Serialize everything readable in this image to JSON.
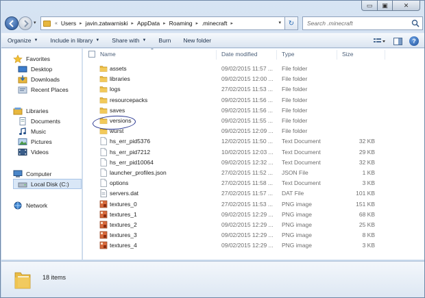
{
  "window": {
    "caption_buttons": {
      "minimize": "▭",
      "maximize": "▣",
      "close": "✕"
    }
  },
  "address_bar": {
    "overflow_marker": "«",
    "breadcrumbs": [
      "Users",
      "javin.zatwarniski",
      "AppData",
      "Roaming",
      ".minecraft"
    ],
    "dropdown_glyph": "▾",
    "refresh_glyph": "↻"
  },
  "search": {
    "placeholder": "Search .minecraft"
  },
  "toolbar": {
    "organize": "Organize",
    "include_in_library": "Include in library",
    "share_with": "Share with",
    "burn": "Burn",
    "new_folder": "New folder",
    "help": "?"
  },
  "nav_pane": {
    "favorites": "Favorites",
    "desktop": "Desktop",
    "downloads": "Downloads",
    "recent_places": "Recent Places",
    "libraries": "Libraries",
    "documents": "Documents",
    "music": "Music",
    "pictures": "Pictures",
    "videos": "Videos",
    "computer": "Computer",
    "local_disk": "Local Disk (C:)",
    "network": "Network"
  },
  "columns": {
    "name": "Name",
    "date_modified": "Date modified",
    "type": "Type",
    "size": "Size"
  },
  "files": [
    {
      "name": "assets",
      "date": "09/02/2015 11:57 ...",
      "type": "File folder",
      "size": "",
      "icon": "folder-icon"
    },
    {
      "name": "libraries",
      "date": "09/02/2015 12:00 ...",
      "type": "File folder",
      "size": "",
      "icon": "folder-icon"
    },
    {
      "name": "logs",
      "date": "27/02/2015 11:53 ...",
      "type": "File folder",
      "size": "",
      "icon": "folder-icon"
    },
    {
      "name": "resourcepacks",
      "date": "09/02/2015 11:56 ...",
      "type": "File folder",
      "size": "",
      "icon": "folder-icon"
    },
    {
      "name": "saves",
      "date": "09/02/2015 11:56 ...",
      "type": "File folder",
      "size": "",
      "icon": "folder-icon"
    },
    {
      "name": "versions",
      "date": "09/02/2015 11:55 ...",
      "type": "File folder",
      "size": "",
      "icon": "folder-icon"
    },
    {
      "name": "wurst",
      "date": "09/02/2015 12:09 ...",
      "type": "File folder",
      "size": "",
      "icon": "folder-icon"
    },
    {
      "name": "hs_err_pid5376",
      "date": "12/02/2015 11:50 ...",
      "type": "Text Document",
      "size": "32 KB",
      "icon": "text-file-icon"
    },
    {
      "name": "hs_err_pid7212",
      "date": "10/02/2015 12:03 ...",
      "type": "Text Document",
      "size": "29 KB",
      "icon": "text-file-icon"
    },
    {
      "name": "hs_err_pid10064",
      "date": "09/02/2015 12:32 ...",
      "type": "Text Document",
      "size": "32 KB",
      "icon": "text-file-icon"
    },
    {
      "name": "launcher_profiles.json",
      "date": "27/02/2015 11:52 ...",
      "type": "JSON File",
      "size": "1 KB",
      "icon": "text-file-icon"
    },
    {
      "name": "options",
      "date": "27/02/2015 11:58 ...",
      "type": "Text Document",
      "size": "3 KB",
      "icon": "text-file-icon"
    },
    {
      "name": "servers.dat",
      "date": "27/02/2015 11:57 ...",
      "type": "DAT File",
      "size": "101 KB",
      "icon": "dat-file-icon"
    },
    {
      "name": "textures_0",
      "date": "27/02/2015 11:53 ...",
      "type": "PNG image",
      "size": "151 KB",
      "icon": "png-image-icon"
    },
    {
      "name": "textures_1",
      "date": "09/02/2015 12:29 ...",
      "type": "PNG image",
      "size": "68 KB",
      "icon": "png-image-icon"
    },
    {
      "name": "textures_2",
      "date": "09/02/2015 12:29 ...",
      "type": "PNG image",
      "size": "25 KB",
      "icon": "png-image-icon"
    },
    {
      "name": "textures_3",
      "date": "09/02/2015 12:29 ...",
      "type": "PNG image",
      "size": "8 KB",
      "icon": "png-image-icon"
    },
    {
      "name": "textures_4",
      "date": "09/02/2015 12:29 ...",
      "type": "PNG image",
      "size": "3 KB",
      "icon": "png-image-icon"
    }
  ],
  "status": {
    "item_count": "18 items"
  },
  "colors": {
    "folder": "#e7b73e",
    "selection": "#d9e7f7",
    "annotation_ring": "#25338f"
  }
}
